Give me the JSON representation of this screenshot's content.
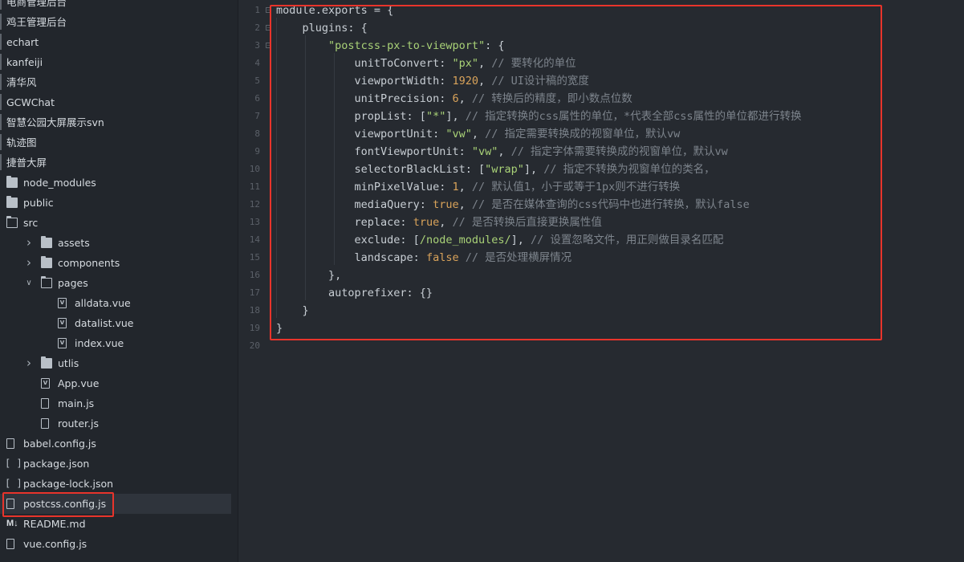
{
  "sidebar": {
    "items": [
      {
        "label": "电商管理后台",
        "kind": "project"
      },
      {
        "label": "鸡王管理后台",
        "kind": "project"
      },
      {
        "label": "echart",
        "kind": "project"
      },
      {
        "label": "kanfeiji",
        "kind": "project"
      },
      {
        "label": "清华风",
        "kind": "project"
      },
      {
        "label": "GCWChat",
        "kind": "project"
      },
      {
        "label": "智慧公园大屏展示svn",
        "kind": "project"
      },
      {
        "label": "轨迹图",
        "kind": "project"
      },
      {
        "label": "捷普大屏",
        "kind": "project"
      },
      {
        "label": "node_modules",
        "kind": "folder",
        "depth": 0,
        "icon": "folder-icon"
      },
      {
        "label": "public",
        "kind": "folder",
        "depth": 0,
        "icon": "folder-icon"
      },
      {
        "label": "src",
        "kind": "folder-open",
        "depth": 0,
        "icon": "folder-open-icon"
      },
      {
        "label": "assets",
        "kind": "folder",
        "depth": 1,
        "chevron": "right",
        "icon": "folder-icon"
      },
      {
        "label": "components",
        "kind": "folder",
        "depth": 1,
        "chevron": "right",
        "icon": "folder-icon"
      },
      {
        "label": "pages",
        "kind": "folder-open",
        "depth": 1,
        "chevron": "down",
        "icon": "folder-open-icon"
      },
      {
        "label": "alldata.vue",
        "kind": "vue",
        "depth": 2,
        "icon": "vue-file-icon"
      },
      {
        "label": "datalist.vue",
        "kind": "vue",
        "depth": 2,
        "icon": "vue-file-icon"
      },
      {
        "label": "index.vue",
        "kind": "vue",
        "depth": 2,
        "icon": "vue-file-icon"
      },
      {
        "label": "utlis",
        "kind": "folder",
        "depth": 1,
        "chevron": "right",
        "icon": "folder-icon"
      },
      {
        "label": "App.vue",
        "kind": "vue",
        "depth": 1,
        "icon": "vue-file-icon"
      },
      {
        "label": "main.js",
        "kind": "file",
        "depth": 1,
        "icon": "file-icon"
      },
      {
        "label": "router.js",
        "kind": "file",
        "depth": 1,
        "icon": "file-icon"
      },
      {
        "label": "babel.config.js",
        "kind": "file",
        "depth": 0,
        "icon": "file-icon"
      },
      {
        "label": "package.json",
        "kind": "json",
        "depth": 0,
        "icon": "json-file-icon"
      },
      {
        "label": "package-lock.json",
        "kind": "json",
        "depth": 0,
        "icon": "json-file-icon"
      },
      {
        "label": "postcss.config.js",
        "kind": "file",
        "depth": 0,
        "icon": "file-icon",
        "selected": true
      },
      {
        "label": "README.md",
        "kind": "md",
        "depth": 0,
        "icon": "markdown-icon"
      },
      {
        "label": "vue.config.js",
        "kind": "file",
        "depth": 0,
        "icon": "file-icon"
      }
    ]
  },
  "editor": {
    "line_numbers": [
      "1",
      "2",
      "3",
      "4",
      "5",
      "6",
      "7",
      "8",
      "9",
      "10",
      "11",
      "12",
      "13",
      "14",
      "15",
      "16",
      "17",
      "18",
      "19",
      "20"
    ],
    "lines": [
      [
        {
          "t": "module.exports = {",
          "c": "plain"
        }
      ],
      [
        {
          "t": "    plugins: {",
          "c": "plain"
        }
      ],
      [
        {
          "t": "        ",
          "c": "plain"
        },
        {
          "t": "\"postcss-px-to-viewport\"",
          "c": "str"
        },
        {
          "t": ": {",
          "c": "plain"
        }
      ],
      [
        {
          "t": "            unitToConvert: ",
          "c": "plain"
        },
        {
          "t": "\"px\"",
          "c": "str"
        },
        {
          "t": ", ",
          "c": "plain"
        },
        {
          "t": "// 要转化的单位",
          "c": "cmt"
        }
      ],
      [
        {
          "t": "            viewportWidth: ",
          "c": "plain"
        },
        {
          "t": "1920",
          "c": "num"
        },
        {
          "t": ", ",
          "c": "plain"
        },
        {
          "t": "// UI设计稿的宽度",
          "c": "cmt"
        }
      ],
      [
        {
          "t": "            unitPrecision: ",
          "c": "plain"
        },
        {
          "t": "6",
          "c": "num"
        },
        {
          "t": ", ",
          "c": "plain"
        },
        {
          "t": "// 转换后的精度，即小数点位数",
          "c": "cmt"
        }
      ],
      [
        {
          "t": "            propList: [",
          "c": "plain"
        },
        {
          "t": "\"*\"",
          "c": "str"
        },
        {
          "t": "], ",
          "c": "plain"
        },
        {
          "t": "// 指定转换的css属性的单位，*代表全部css属性的单位都进行转换",
          "c": "cmt"
        }
      ],
      [
        {
          "t": "            viewportUnit: ",
          "c": "plain"
        },
        {
          "t": "\"vw\"",
          "c": "str"
        },
        {
          "t": ", ",
          "c": "plain"
        },
        {
          "t": "// 指定需要转换成的视窗单位，默认vw",
          "c": "cmt"
        }
      ],
      [
        {
          "t": "            fontViewportUnit: ",
          "c": "plain"
        },
        {
          "t": "\"vw\"",
          "c": "str"
        },
        {
          "t": ", ",
          "c": "plain"
        },
        {
          "t": "// 指定字体需要转换成的视窗单位，默认vw",
          "c": "cmt"
        }
      ],
      [
        {
          "t": "            selectorBlackList: [",
          "c": "plain"
        },
        {
          "t": "\"wrap\"",
          "c": "str"
        },
        {
          "t": "], ",
          "c": "plain"
        },
        {
          "t": "// 指定不转换为视窗单位的类名，",
          "c": "cmt"
        }
      ],
      [
        {
          "t": "            minPixelValue: ",
          "c": "plain"
        },
        {
          "t": "1",
          "c": "num"
        },
        {
          "t": ", ",
          "c": "plain"
        },
        {
          "t": "// 默认值1，小于或等于1px则不进行转换",
          "c": "cmt"
        }
      ],
      [
        {
          "t": "            mediaQuery: ",
          "c": "plain"
        },
        {
          "t": "true",
          "c": "num"
        },
        {
          "t": ", ",
          "c": "plain"
        },
        {
          "t": "// 是否在媒体查询的css代码中也进行转换，默认false",
          "c": "cmt"
        }
      ],
      [
        {
          "t": "            replace: ",
          "c": "plain"
        },
        {
          "t": "true",
          "c": "num"
        },
        {
          "t": ", ",
          "c": "plain"
        },
        {
          "t": "// 是否转换后直接更换属性值",
          "c": "cmt"
        }
      ],
      [
        {
          "t": "            exclude: [",
          "c": "plain"
        },
        {
          "t": "/node_modules/",
          "c": "str"
        },
        {
          "t": "], ",
          "c": "plain"
        },
        {
          "t": "// 设置忽略文件，用正则做目录名匹配",
          "c": "cmt"
        }
      ],
      [
        {
          "t": "            landscape: ",
          "c": "plain"
        },
        {
          "t": "false",
          "c": "num"
        },
        {
          "t": " ",
          "c": "plain"
        },
        {
          "t": "// 是否处理横屏情况",
          "c": "cmt"
        }
      ],
      [
        {
          "t": "        },",
          "c": "plain"
        }
      ],
      [
        {
          "t": "        autoprefixer: {}",
          "c": "plain"
        }
      ],
      [
        {
          "t": "    }",
          "c": "plain"
        }
      ],
      [
        {
          "t": "}",
          "c": "plain"
        }
      ],
      [
        {
          "t": "",
          "c": "plain"
        }
      ]
    ]
  },
  "colors": {
    "highlight": "#e8342b",
    "string": "#a9d277",
    "number": "#d9a35a",
    "comment": "#7d848c"
  }
}
